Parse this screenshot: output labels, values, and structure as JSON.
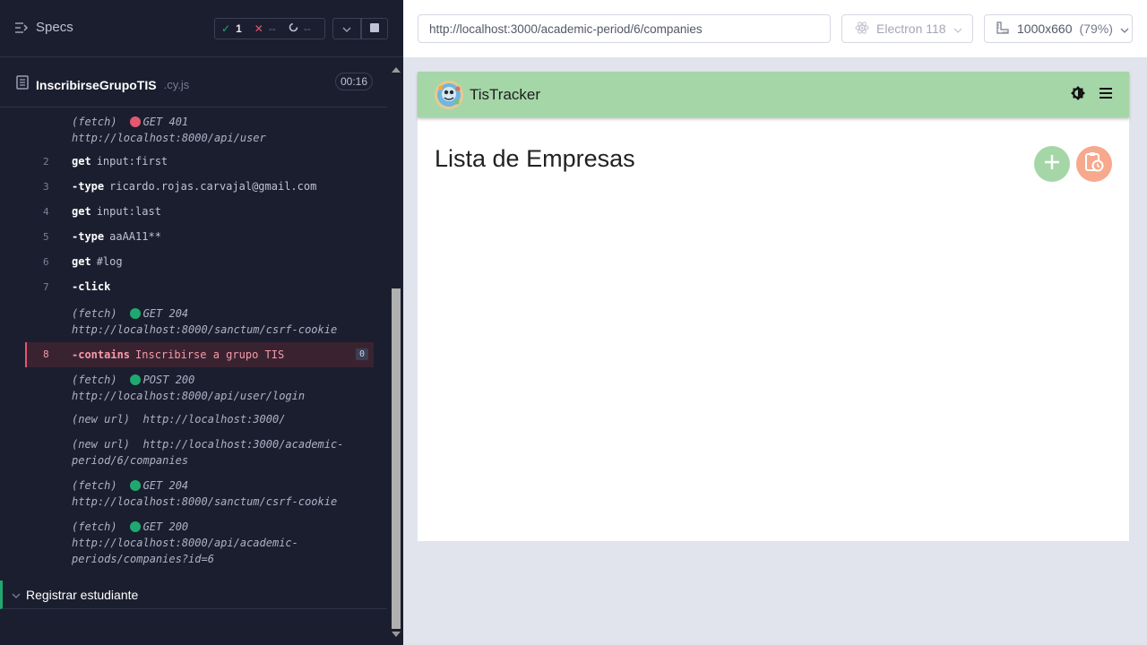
{
  "runner": {
    "specs_label": "Specs",
    "stats": {
      "passed": "1",
      "failed": "--",
      "pending": "--"
    },
    "spec": {
      "name": "InscribirseGrupoTIS",
      "ext": ".cy.js",
      "duration": "00:16"
    },
    "commands": [
      {
        "ln": "",
        "type": "fetch",
        "meta": "(fetch)",
        "status": "red",
        "method": "GET 401",
        "url": "http://localhost:8000/api/user"
      },
      {
        "ln": "2",
        "kw": "get",
        "arg": "input:first"
      },
      {
        "ln": "3",
        "kw": "-type",
        "arg": "ricardo.rojas.carvajal@gmail.com"
      },
      {
        "ln": "4",
        "kw": "get",
        "arg": "input:last"
      },
      {
        "ln": "5",
        "kw": "-type",
        "arg": "aaAA11**"
      },
      {
        "ln": "6",
        "kw": "get",
        "arg": "#log"
      },
      {
        "ln": "7",
        "kw": "-click",
        "arg": ""
      },
      {
        "ln": "",
        "meta": "(fetch)",
        "status": "green",
        "method": "GET 204",
        "url": "http://localhost:8000/sanctum/csrf-cookie"
      },
      {
        "ln": "8",
        "kw": "-contains",
        "arg": "Inscribirse a grupo TIS",
        "badge": "0"
      },
      {
        "ln": "",
        "meta": "(fetch)",
        "status": "green",
        "method": "POST 200",
        "url": "http://localhost:8000/api/user/login"
      },
      {
        "ln": "",
        "meta": "(new url)",
        "url": "http://localhost:3000/"
      },
      {
        "ln": "",
        "meta": "(new url)",
        "url": "http://localhost:3000/academic-",
        "url2": "period/6/companies"
      },
      {
        "ln": "",
        "meta": "(fetch)",
        "status": "green",
        "method": "GET 204",
        "url": "http://localhost:8000/sanctum/csrf-cookie"
      },
      {
        "ln": "",
        "meta": "(fetch)",
        "status": "green",
        "method": "GET 200",
        "url": "http://localhost:8000/api/academic-",
        "url2": "periods/companies?id=6"
      }
    ],
    "next_suite": "Registrar estudiante"
  },
  "browser": {
    "url": "http://localhost:3000/academic-period/6/companies",
    "engine": "Electron 118",
    "viewport": "1000x660",
    "zoom": "(79%)"
  },
  "app": {
    "brand": "TisTracker",
    "page_title": "Lista de Empresas"
  },
  "colors": {
    "runner_bg": "#1b1e2e",
    "pass": "#1fa971",
    "fail": "#e45770",
    "app_bar": "#a5d6a7",
    "fab_add": "#a5d6a7",
    "fab_report": "#f7a98d"
  }
}
